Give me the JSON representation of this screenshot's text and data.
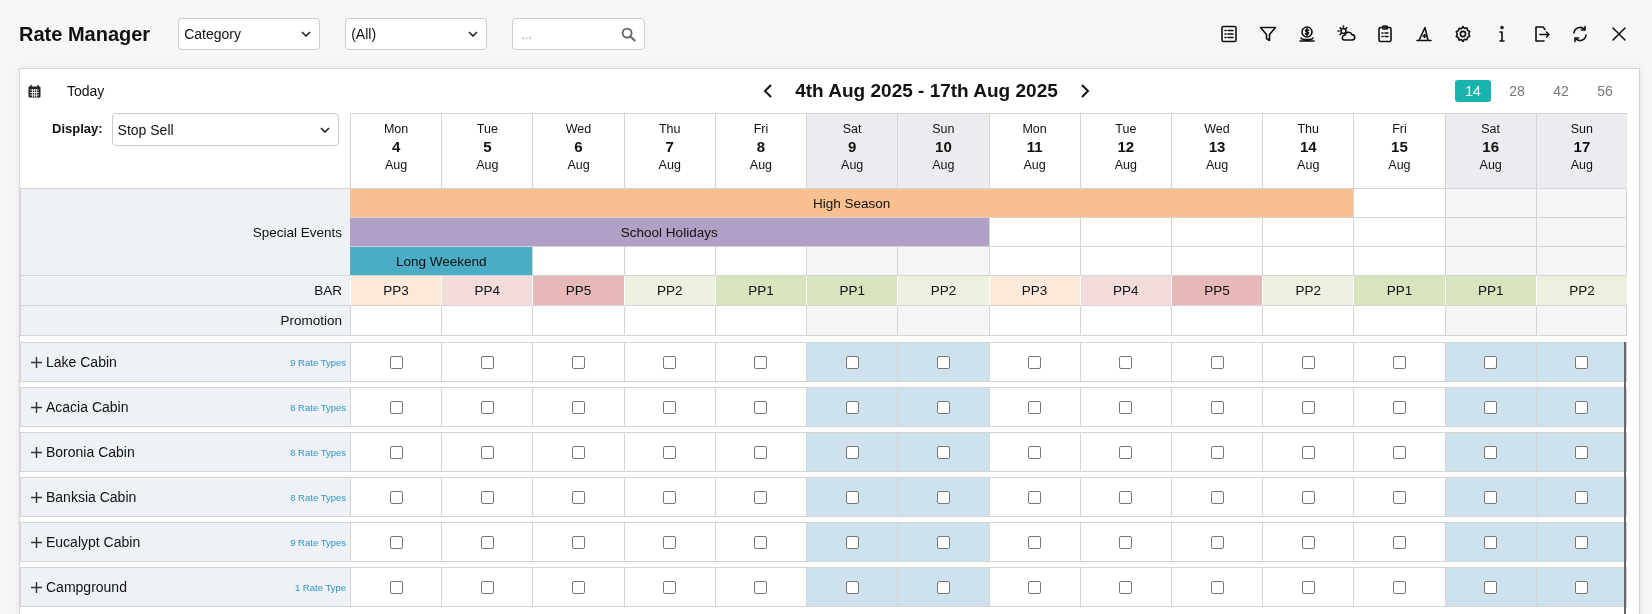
{
  "title": "Rate Manager",
  "filters": [
    {
      "value": "Category"
    },
    {
      "value": "(All)"
    }
  ],
  "search": {
    "placeholder": "..."
  },
  "today_button": "Today",
  "date_range": "4th Aug 2025 - 17th Aug 2025",
  "range_options": [
    {
      "label": "14",
      "selected": true
    },
    {
      "label": "28",
      "selected": false
    },
    {
      "label": "42",
      "selected": false
    },
    {
      "label": "56",
      "selected": false
    }
  ],
  "display": {
    "label": "Display:",
    "value": "Stop Sell"
  },
  "days": [
    {
      "weekday": "Mon",
      "day": "4",
      "month": "Aug",
      "weekend": false
    },
    {
      "weekday": "Tue",
      "day": "5",
      "month": "Aug",
      "weekend": false
    },
    {
      "weekday": "Wed",
      "day": "6",
      "month": "Aug",
      "weekend": false
    },
    {
      "weekday": "Thu",
      "day": "7",
      "month": "Aug",
      "weekend": false
    },
    {
      "weekday": "Fri",
      "day": "8",
      "month": "Aug",
      "weekend": false
    },
    {
      "weekday": "Sat",
      "day": "9",
      "month": "Aug",
      "weekend": true
    },
    {
      "weekday": "Sun",
      "day": "10",
      "month": "Aug",
      "weekend": true
    },
    {
      "weekday": "Mon",
      "day": "11",
      "month": "Aug",
      "weekend": false
    },
    {
      "weekday": "Tue",
      "day": "12",
      "month": "Aug",
      "weekend": false
    },
    {
      "weekday": "Wed",
      "day": "13",
      "month": "Aug",
      "weekend": false
    },
    {
      "weekday": "Thu",
      "day": "14",
      "month": "Aug",
      "weekend": false
    },
    {
      "weekday": "Fri",
      "day": "15",
      "month": "Aug",
      "weekend": false
    },
    {
      "weekday": "Sat",
      "day": "16",
      "month": "Aug",
      "weekend": true
    },
    {
      "weekday": "Sun",
      "day": "17",
      "month": "Aug",
      "weekend": true
    }
  ],
  "special_events": {
    "label": "Special Events",
    "events": [
      {
        "label": "High Season",
        "color": "#f9c08f",
        "days": [
          true,
          true,
          true,
          true,
          true,
          true,
          true,
          true,
          true,
          true,
          true,
          false,
          false,
          false
        ]
      },
      {
        "label": "School Holidays",
        "color": "#b1a0c6",
        "days": [
          true,
          true,
          true,
          true,
          true,
          true,
          true,
          false,
          false,
          false,
          false,
          false,
          false,
          false
        ]
      },
      {
        "label": "Long Weekend",
        "color": "#4bacc6",
        "days": [
          true,
          true,
          false,
          false,
          false,
          false,
          false,
          false,
          false,
          false,
          false,
          false,
          false,
          false
        ]
      }
    ]
  },
  "bar": {
    "label": "BAR",
    "cells": [
      {
        "value": "PP3",
        "color": "#fde9d9"
      },
      {
        "value": "PP4",
        "color": "#f2dcdb"
      },
      {
        "value": "PP5",
        "color": "#e6b8b7"
      },
      {
        "value": "PP2",
        "color": "#ebf1de"
      },
      {
        "value": "PP1",
        "color": "#d7e4bd"
      },
      {
        "value": "PP1",
        "color": "#d7e4bd"
      },
      {
        "value": "PP2",
        "color": "#ebf1de"
      },
      {
        "value": "PP3",
        "color": "#fde9d9"
      },
      {
        "value": "PP4",
        "color": "#f2dcdb"
      },
      {
        "value": "PP5",
        "color": "#e6b8b7"
      },
      {
        "value": "PP2",
        "color": "#ebf1de"
      },
      {
        "value": "PP1",
        "color": "#d7e4bd"
      },
      {
        "value": "PP1",
        "color": "#d7e4bd"
      },
      {
        "value": "PP2",
        "color": "#ebf1de"
      }
    ]
  },
  "promotion": {
    "label": "Promotion"
  },
  "rooms": [
    {
      "name": "Lake Cabin",
      "rate_types": "9 Rate Types",
      "stop_sell": [
        false,
        false,
        false,
        false,
        false,
        false,
        false,
        false,
        false,
        false,
        false,
        false,
        false,
        false
      ]
    },
    {
      "name": "Acacia Cabin",
      "rate_types": "8 Rate Types",
      "stop_sell": [
        false,
        false,
        false,
        false,
        false,
        false,
        false,
        false,
        false,
        false,
        false,
        false,
        false,
        false
      ]
    },
    {
      "name": "Boronia Cabin",
      "rate_types": "8 Rate Types",
      "stop_sell": [
        false,
        false,
        false,
        false,
        false,
        false,
        false,
        false,
        false,
        false,
        false,
        false,
        false,
        false
      ]
    },
    {
      "name": "Banksia Cabin",
      "rate_types": "8 Rate Types",
      "stop_sell": [
        false,
        false,
        false,
        false,
        false,
        false,
        false,
        false,
        false,
        false,
        false,
        false,
        false,
        false
      ]
    },
    {
      "name": "Eucalypt Cabin",
      "rate_types": "9 Rate Types",
      "stop_sell": [
        false,
        false,
        false,
        false,
        false,
        false,
        false,
        false,
        false,
        false,
        false,
        false,
        false,
        false
      ]
    },
    {
      "name": "Campground",
      "rate_types": "1 Rate Type",
      "stop_sell": [
        false,
        false,
        false,
        false,
        false,
        false,
        false,
        false,
        false,
        false,
        false,
        false,
        false,
        false
      ]
    }
  ]
}
